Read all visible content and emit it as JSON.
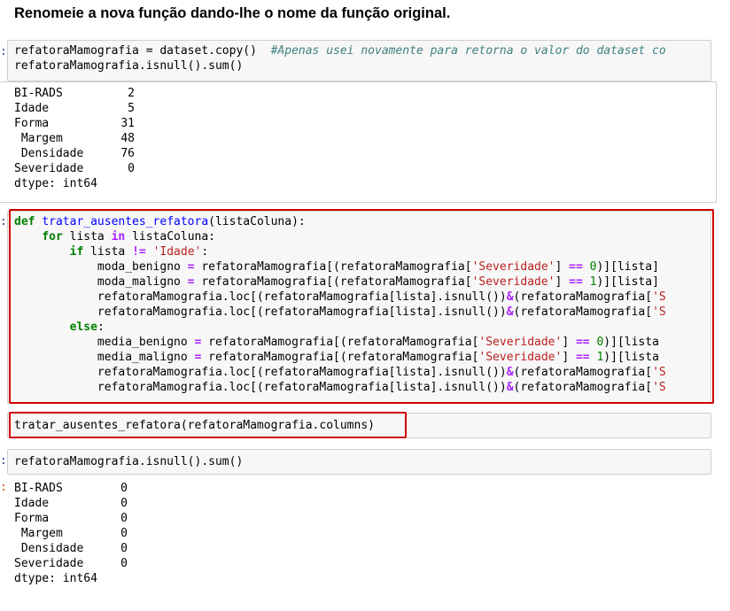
{
  "heading": "Renomeie a nova função dando-lhe o nome da função original.",
  "cell1": {
    "line1_code": "refatoraMamografia = dataset.copy()",
    "line1_comment": "#Apenas usei novamente para retorna o valor do dataset co",
    "line2": "refatoraMamografia.isnull().sum()"
  },
  "output1": [
    {
      "label": "BI-RADS",
      "value": "2"
    },
    {
      "label": "Idade",
      "value": "5"
    },
    {
      "label": "Forma",
      "value": "31"
    },
    {
      "label": " Margem",
      "value": "48"
    },
    {
      "label": " Densidade",
      "value": "76"
    },
    {
      "label": "Severidade",
      "value": "0"
    }
  ],
  "output1_dtype": "dtype: int64",
  "cell2": {
    "def_kw": "def",
    "func_name": "tratar_ausentes_refatora",
    "param": "(listaColuna):",
    "for_kw": "for",
    "for_var": "lista",
    "in_kw": "in",
    "for_iter": "listaColuna:",
    "if_kw": "if",
    "if_var": "lista",
    "neq": "!=",
    "if_str": "'Idade'",
    "colon": ":",
    "l4_a": "moda_benigno",
    "l4_b": "refatoraMamografia[(refatoraMamografia[",
    "l4_str": "'Severidade'",
    "l4_c": "]",
    "l4_num": "0",
    "l4_d": ")][lista]",
    "l5_a": "moda_maligno",
    "l5_num": "1",
    "l6_a": "refatoraMamografia.loc[(refatoraMamografia[lista].isnull())",
    "amp": "&",
    "l6_b": "(refatoraMamografia[",
    "l6_str": "'S",
    "else_kw": "else",
    "l8_a": "media_benigno",
    "l9_a": "media_maligno",
    "l4_d2": ")][lista"
  },
  "cell3": "tratar_ausentes_refatora(refatoraMamografia.columns)",
  "cell4": "refatoraMamografia.isnull().sum()",
  "output2": [
    {
      "label": "BI-RADS",
      "value": "0"
    },
    {
      "label": "Idade",
      "value": "0"
    },
    {
      "label": "Forma",
      "value": "0"
    },
    {
      "label": " Margem",
      "value": "0"
    },
    {
      "label": " Densidade",
      "value": "0"
    },
    {
      "label": "Severidade",
      "value": "0"
    }
  ],
  "output2_dtype": "dtype: int64",
  "prompt_in": ":",
  "prompt_out": ":",
  "eq": "=",
  "eqeq": "==",
  "colors": {
    "red_highlight": "#d00000",
    "keyword": "#008000",
    "string": "#ba2121",
    "operator": "#aa22ff",
    "comment": "#408080"
  }
}
